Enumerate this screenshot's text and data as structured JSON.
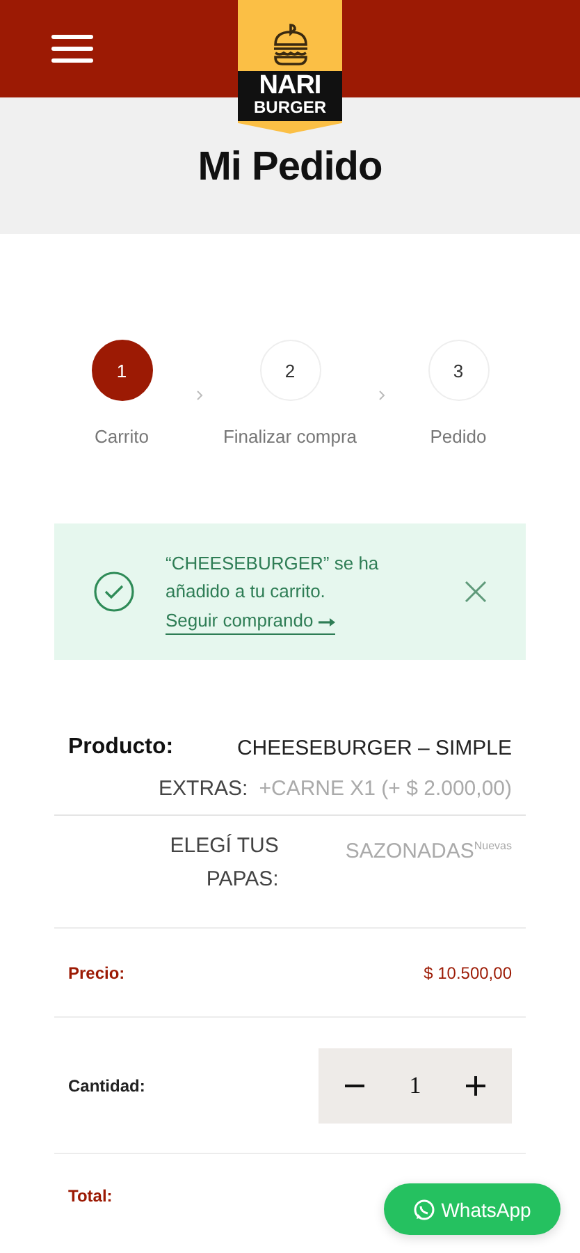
{
  "logo": {
    "line_1": "NARI",
    "line_2": "BURGER"
  },
  "page_title": "Mi Pedido",
  "steps": [
    {
      "number": "1",
      "label": "Carrito",
      "selected": true
    },
    {
      "number": "2",
      "label": "Finalizar compra",
      "selected": false
    },
    {
      "number": "3",
      "label": "Pedido",
      "selected": false
    }
  ],
  "notice": {
    "message": "“CHEESEBURGER” se ha añadido a tu carrito.",
    "link": "Seguir comprando"
  },
  "product": {
    "label": "Producto:",
    "value": "CHEESEBURGER – SIMPLE",
    "options": [
      {
        "label": "EXTRAS:",
        "value": "+CARNE X1 (+ $ 2.000,00)"
      },
      {
        "label": "ELEGÍ TUS PAPAS:",
        "value": "SAZONADAS$^{Nuevas}$"
      }
    ]
  },
  "price": {
    "label": "Precio:",
    "value": "$ 10.500,00"
  },
  "quantity": {
    "label": "Cantidad:",
    "value": "1"
  },
  "total": {
    "label": "Total:"
  },
  "whatsapp": {
    "label": "WhatsApp"
  }
}
